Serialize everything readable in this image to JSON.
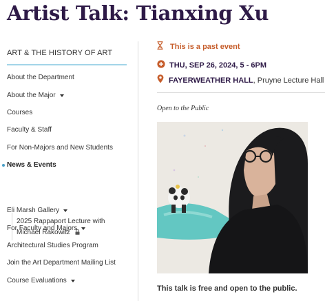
{
  "page": {
    "title": "Artist Talk: Tianxing Xu"
  },
  "sidebar": {
    "heading": "ART & THE HISTORY OF ART",
    "items": [
      {
        "label": "About the Department",
        "has_caret": false
      },
      {
        "label": "About the Major",
        "has_caret": true
      },
      {
        "label": "Courses",
        "has_caret": false
      },
      {
        "label": "Faculty & Staff",
        "has_caret": false
      },
      {
        "label": "For Non-Majors and New Students",
        "has_caret": false
      },
      {
        "label": "News & Events",
        "has_caret": false,
        "active": true
      },
      {
        "label": "Eli Marsh Gallery",
        "has_caret": true
      },
      {
        "label": "For Faculty and Majors",
        "has_caret": true
      },
      {
        "label": "Architectural Studies Program",
        "has_caret": false
      },
      {
        "label": "Join the Art Department Mailing List",
        "has_caret": false
      },
      {
        "label": "Course Evaluations",
        "has_caret": true
      }
    ],
    "subitem": {
      "label": "2025 Rappaport Lecture with Michael Rakowitz",
      "locked": true
    }
  },
  "event": {
    "status": "This is a past event",
    "date": "THU, SEP 26, 2024, 5 - 6PM",
    "venue": "FAYERWEATHER HALL",
    "room": ", Pruyne Lecture Hall",
    "audience": "Open to the Public",
    "description": "This talk is free and open to the public."
  },
  "colors": {
    "title": "#2e1a47",
    "accent": "#c65d2b",
    "rule": "#a3d5e8",
    "active_dot": "#4a9fc7"
  },
  "icons": {
    "status": "hourglass-icon",
    "date": "plus-circle-icon",
    "venue": "map-pin-icon",
    "subitem": "lock-icon"
  }
}
